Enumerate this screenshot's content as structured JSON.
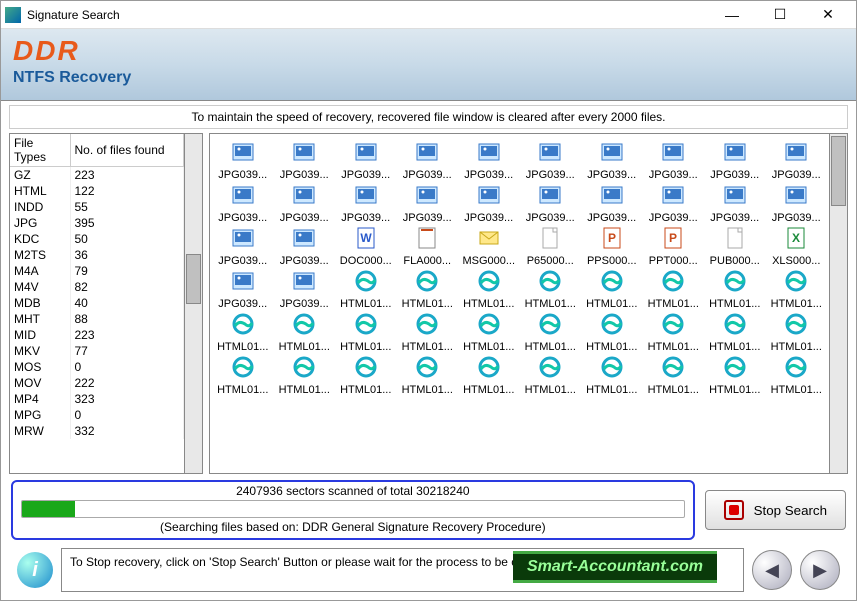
{
  "window": {
    "title": "Signature Search"
  },
  "banner": {
    "brand": "DDR",
    "subtitle": "NTFS Recovery"
  },
  "info": "To maintain the speed of recovery, recovered file window is cleared after every 2000 files.",
  "table": {
    "headers": [
      "File Types",
      "No. of files found"
    ],
    "rows": [
      [
        "GZ",
        "223"
      ],
      [
        "HTML",
        "122"
      ],
      [
        "INDD",
        "55"
      ],
      [
        "JPG",
        "395"
      ],
      [
        "KDC",
        "50"
      ],
      [
        "M2TS",
        "36"
      ],
      [
        "M4A",
        "79"
      ],
      [
        "M4V",
        "82"
      ],
      [
        "MDB",
        "40"
      ],
      [
        "MHT",
        "88"
      ],
      [
        "MID",
        "223"
      ],
      [
        "MKV",
        "77"
      ],
      [
        "MOS",
        "0"
      ],
      [
        "MOV",
        "222"
      ],
      [
        "MP4",
        "323"
      ],
      [
        "MPG",
        "0"
      ],
      [
        "MRW",
        "332"
      ]
    ]
  },
  "files": [
    {
      "n": "JPG039...",
      "i": "jpg"
    },
    {
      "n": "JPG039...",
      "i": "jpg"
    },
    {
      "n": "JPG039...",
      "i": "jpg"
    },
    {
      "n": "JPG039...",
      "i": "jpg"
    },
    {
      "n": "JPG039...",
      "i": "jpg"
    },
    {
      "n": "JPG039...",
      "i": "jpg"
    },
    {
      "n": "JPG039...",
      "i": "jpg"
    },
    {
      "n": "JPG039...",
      "i": "jpg"
    },
    {
      "n": "JPG039...",
      "i": "jpg"
    },
    {
      "n": "JPG039...",
      "i": "jpg"
    },
    {
      "n": "JPG039...",
      "i": "jpg"
    },
    {
      "n": "JPG039...",
      "i": "jpg"
    },
    {
      "n": "JPG039...",
      "i": "jpg"
    },
    {
      "n": "JPG039...",
      "i": "jpg"
    },
    {
      "n": "JPG039...",
      "i": "jpg"
    },
    {
      "n": "JPG039...",
      "i": "jpg"
    },
    {
      "n": "JPG039...",
      "i": "jpg"
    },
    {
      "n": "JPG039...",
      "i": "jpg"
    },
    {
      "n": "JPG039...",
      "i": "jpg"
    },
    {
      "n": "JPG039...",
      "i": "jpg"
    },
    {
      "n": "JPG039...",
      "i": "jpg"
    },
    {
      "n": "JPG039...",
      "i": "jpg"
    },
    {
      "n": "DOC000...",
      "i": "doc"
    },
    {
      "n": "FLA000...",
      "i": "fla"
    },
    {
      "n": "MSG000...",
      "i": "msg"
    },
    {
      "n": "P65000...",
      "i": "gen"
    },
    {
      "n": "PPS000...",
      "i": "pps"
    },
    {
      "n": "PPT000...",
      "i": "ppt"
    },
    {
      "n": "PUB000...",
      "i": "gen"
    },
    {
      "n": "XLS000...",
      "i": "xls"
    },
    {
      "n": "JPG039...",
      "i": "jpg"
    },
    {
      "n": "JPG039...",
      "i": "jpg"
    },
    {
      "n": "HTML01...",
      "i": "html"
    },
    {
      "n": "HTML01...",
      "i": "html"
    },
    {
      "n": "HTML01...",
      "i": "html"
    },
    {
      "n": "HTML01...",
      "i": "html"
    },
    {
      "n": "HTML01...",
      "i": "html"
    },
    {
      "n": "HTML01...",
      "i": "html"
    },
    {
      "n": "HTML01...",
      "i": "html"
    },
    {
      "n": "HTML01...",
      "i": "html"
    },
    {
      "n": "HTML01...",
      "i": "html"
    },
    {
      "n": "HTML01...",
      "i": "html"
    },
    {
      "n": "HTML01...",
      "i": "html"
    },
    {
      "n": "HTML01...",
      "i": "html"
    },
    {
      "n": "HTML01...",
      "i": "html"
    },
    {
      "n": "HTML01...",
      "i": "html"
    },
    {
      "n": "HTML01...",
      "i": "html"
    },
    {
      "n": "HTML01...",
      "i": "html"
    },
    {
      "n": "HTML01...",
      "i": "html"
    },
    {
      "n": "HTML01...",
      "i": "html"
    },
    {
      "n": "HTML01...",
      "i": "html"
    },
    {
      "n": "HTML01...",
      "i": "html"
    },
    {
      "n": "HTML01...",
      "i": "html"
    },
    {
      "n": "HTML01...",
      "i": "html"
    },
    {
      "n": "HTML01...",
      "i": "html"
    },
    {
      "n": "HTML01...",
      "i": "html"
    },
    {
      "n": "HTML01...",
      "i": "html"
    },
    {
      "n": "HTML01...",
      "i": "html"
    },
    {
      "n": "HTML01...",
      "i": "html"
    },
    {
      "n": "HTML01...",
      "i": "html"
    }
  ],
  "progress": {
    "status": "2407936 sectors scanned of total 30218240",
    "note": "(Searching files based on:  DDR General Signature Recovery Procedure)"
  },
  "stop_label": "Stop Search",
  "footer_text": "To Stop recovery, click on 'Stop Search' Button or please wait for the process to be completed.",
  "smart": "Smart-Accountant.com"
}
